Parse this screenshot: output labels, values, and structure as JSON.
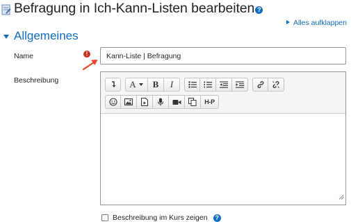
{
  "header": {
    "title": "Befragung in Ich-Kann-Listen bearbeiten",
    "page_icon": "edit-form-icon",
    "help_icon": "help-icon",
    "help_glyph": "?"
  },
  "expand_all": {
    "label": "Alles aufklappen"
  },
  "section": {
    "title": "Allgemeines"
  },
  "name_field": {
    "label": "Name",
    "value": "Kann-Liste | Befragung",
    "required_glyph": "!",
    "required_icon": "required-icon",
    "annotation_icon": "arrow-icon"
  },
  "description": {
    "label": "Beschreibung",
    "toolbar_row1": [
      "show-more-buttons-icon",
      "font-color-icon",
      "bold-icon",
      "italic-icon",
      "unordered-list-icon",
      "ordered-list-icon",
      "outdent-icon",
      "indent-icon",
      "link-icon",
      "unlink-icon"
    ],
    "toolbar_row2": [
      "emoticon-icon",
      "image-icon",
      "media-icon",
      "record-audio-icon",
      "record-video-icon",
      "manage-files-icon",
      "h5p-icon"
    ],
    "bold_glyph": "B",
    "italic_glyph": "I",
    "font_glyph": "A",
    "h5p_glyph": "H-P",
    "content": ""
  },
  "show_in_course": {
    "label": "Beschreibung im Kurs zeigen",
    "checked": false,
    "help_glyph": "?"
  },
  "colors": {
    "link": "#0f6cbf",
    "required": "#ca3120",
    "annotation": "#e8452c"
  }
}
